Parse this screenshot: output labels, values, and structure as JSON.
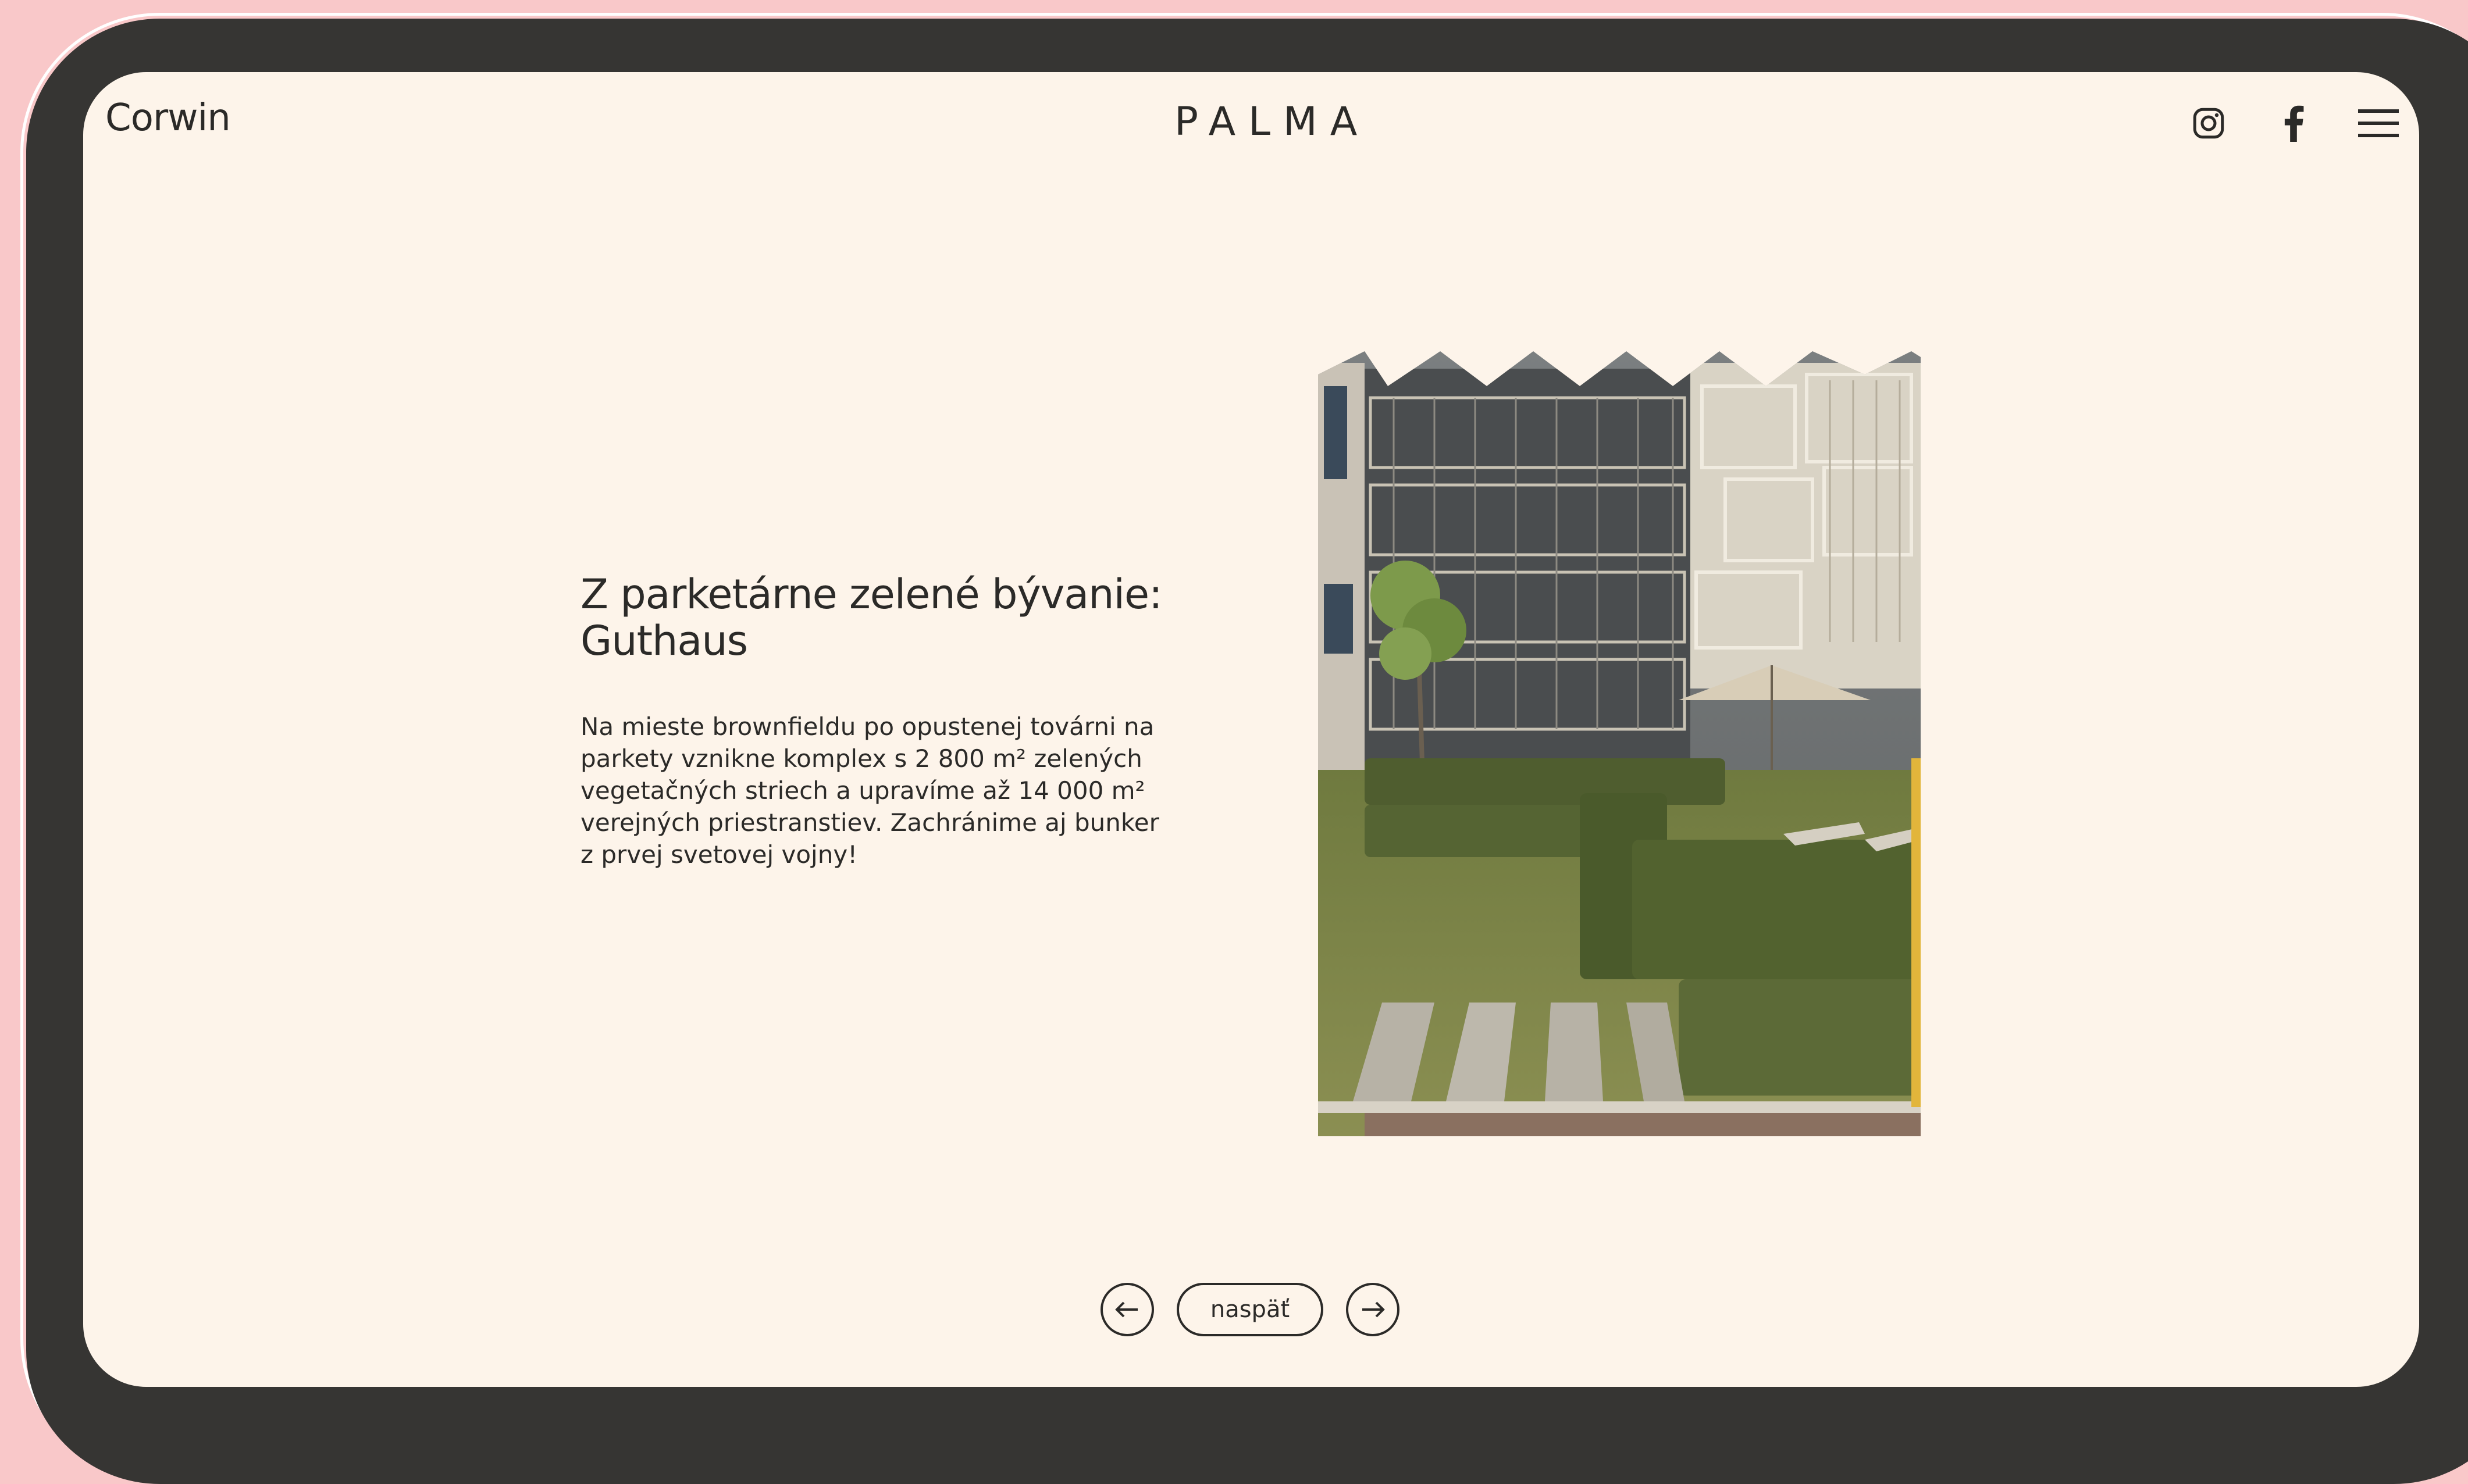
{
  "header": {
    "brand": "Corwin",
    "logo": "PALMA",
    "icons": [
      {
        "name": "instagram-icon"
      },
      {
        "name": "facebook-icon"
      },
      {
        "name": "hamburger-menu-icon"
      }
    ]
  },
  "article": {
    "title_lines": [
      "Z parketárne zelené bývanie:",
      "Guthaus"
    ],
    "body_lines": [
      "Na mieste brownfieldu po opustenej továrni na",
      "parkety vznikne komplex s 2 800 m² zelených",
      "vegetačných striech a upravíme až 14 000 m²",
      "verejných priestranstiev. Zachránime aj bunker",
      "z prvej svetovej vojny!"
    ]
  },
  "navigation": {
    "prev_icon": "arrow-left-icon",
    "back_label": "naspäť",
    "next_icon": "arrow-right-icon"
  },
  "colors": {
    "page_background": "#f9c8c9",
    "device_frame": "#363533",
    "screen_background": "#fdf4ea",
    "text": "#2b2a28"
  }
}
